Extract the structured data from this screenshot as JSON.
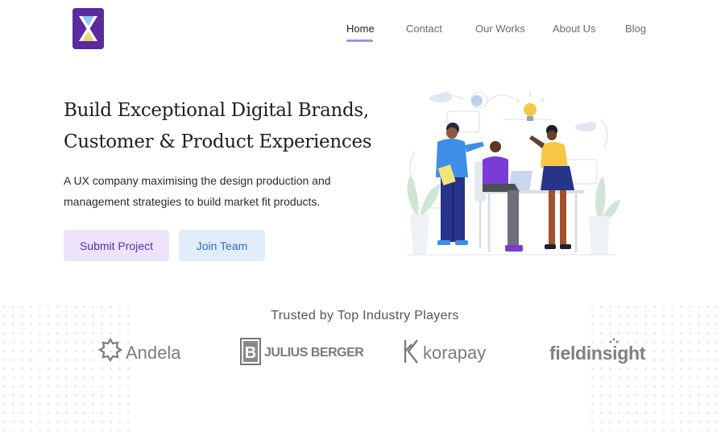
{
  "nav": {
    "items": [
      {
        "label": "Home",
        "active": true
      },
      {
        "label": "Contact"
      },
      {
        "label": "Our Works"
      },
      {
        "label": "About Us"
      },
      {
        "label": "Blog"
      }
    ]
  },
  "hero": {
    "title_line1": "Build Exceptional Digital Brands,",
    "title_line2": "Customer & Product Experiences",
    "desc_line1": "A UX company maximising the design production and",
    "desc_line2": "management strategies to build market fit products.",
    "submit_label": "Submit Project",
    "join_label": "Join Team"
  },
  "trusted": {
    "title": "Trusted by Top Industry Players",
    "brands": [
      {
        "name": "Andela",
        "icon": "andela-star-icon"
      },
      {
        "name": "JULIUS BERGER",
        "icon": "julius-berger-b-icon"
      },
      {
        "name": "korapay",
        "icon": "korapay-k-icon"
      },
      {
        "name": "fieldinsight",
        "icon": "fieldinsight-dots-icon"
      }
    ]
  },
  "colors": {
    "accent_purple": "#5b2a9e",
    "nav_underline": "#a98ee6",
    "submit_bg": "#ece3fb",
    "join_bg": "#e2edfb"
  }
}
